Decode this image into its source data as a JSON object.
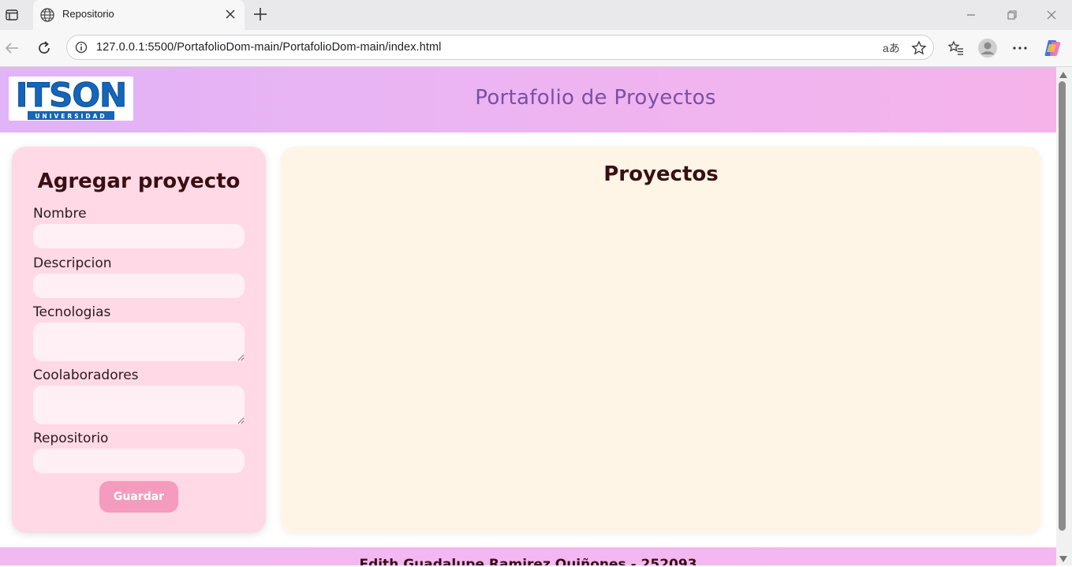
{
  "browser": {
    "tab_title": "Repositorio",
    "url": "127.0.0.1:5500/PortafolioDom-main/PortafolioDom-main/index.html",
    "read_aloud_glyph": "aあ"
  },
  "header": {
    "logo_text": "ITSON",
    "logo_subtext": "UNIVERSIDAD",
    "title": "Portafolio de Proyectos"
  },
  "form": {
    "title": "Agregar proyecto",
    "fields": {
      "nombre": {
        "label": "Nombre",
        "value": ""
      },
      "descripcion": {
        "label": "Descripcion",
        "value": ""
      },
      "tecnologias": {
        "label": "Tecnologias",
        "value": ""
      },
      "colaboradores": {
        "label": "Coolaboradores",
        "value": ""
      },
      "repositorio": {
        "label": "Repositorio",
        "value": ""
      }
    },
    "save_label": "Guardar"
  },
  "projects": {
    "title": "Proyectos"
  },
  "footer": {
    "text": "Edith Guadalupe Ramirez Quiñones - 252093"
  },
  "colors": {
    "header_gradient_start": "#e1b3f7",
    "header_gradient_end": "#f5b3ea",
    "header_title": "#7b4fa6",
    "form_card_bg": "#ffd9e6",
    "projects_card_bg": "#fef5e6",
    "save_button": "#f59bbd",
    "heading_text": "#3a0f14",
    "logo_blue": "#1565b8"
  }
}
